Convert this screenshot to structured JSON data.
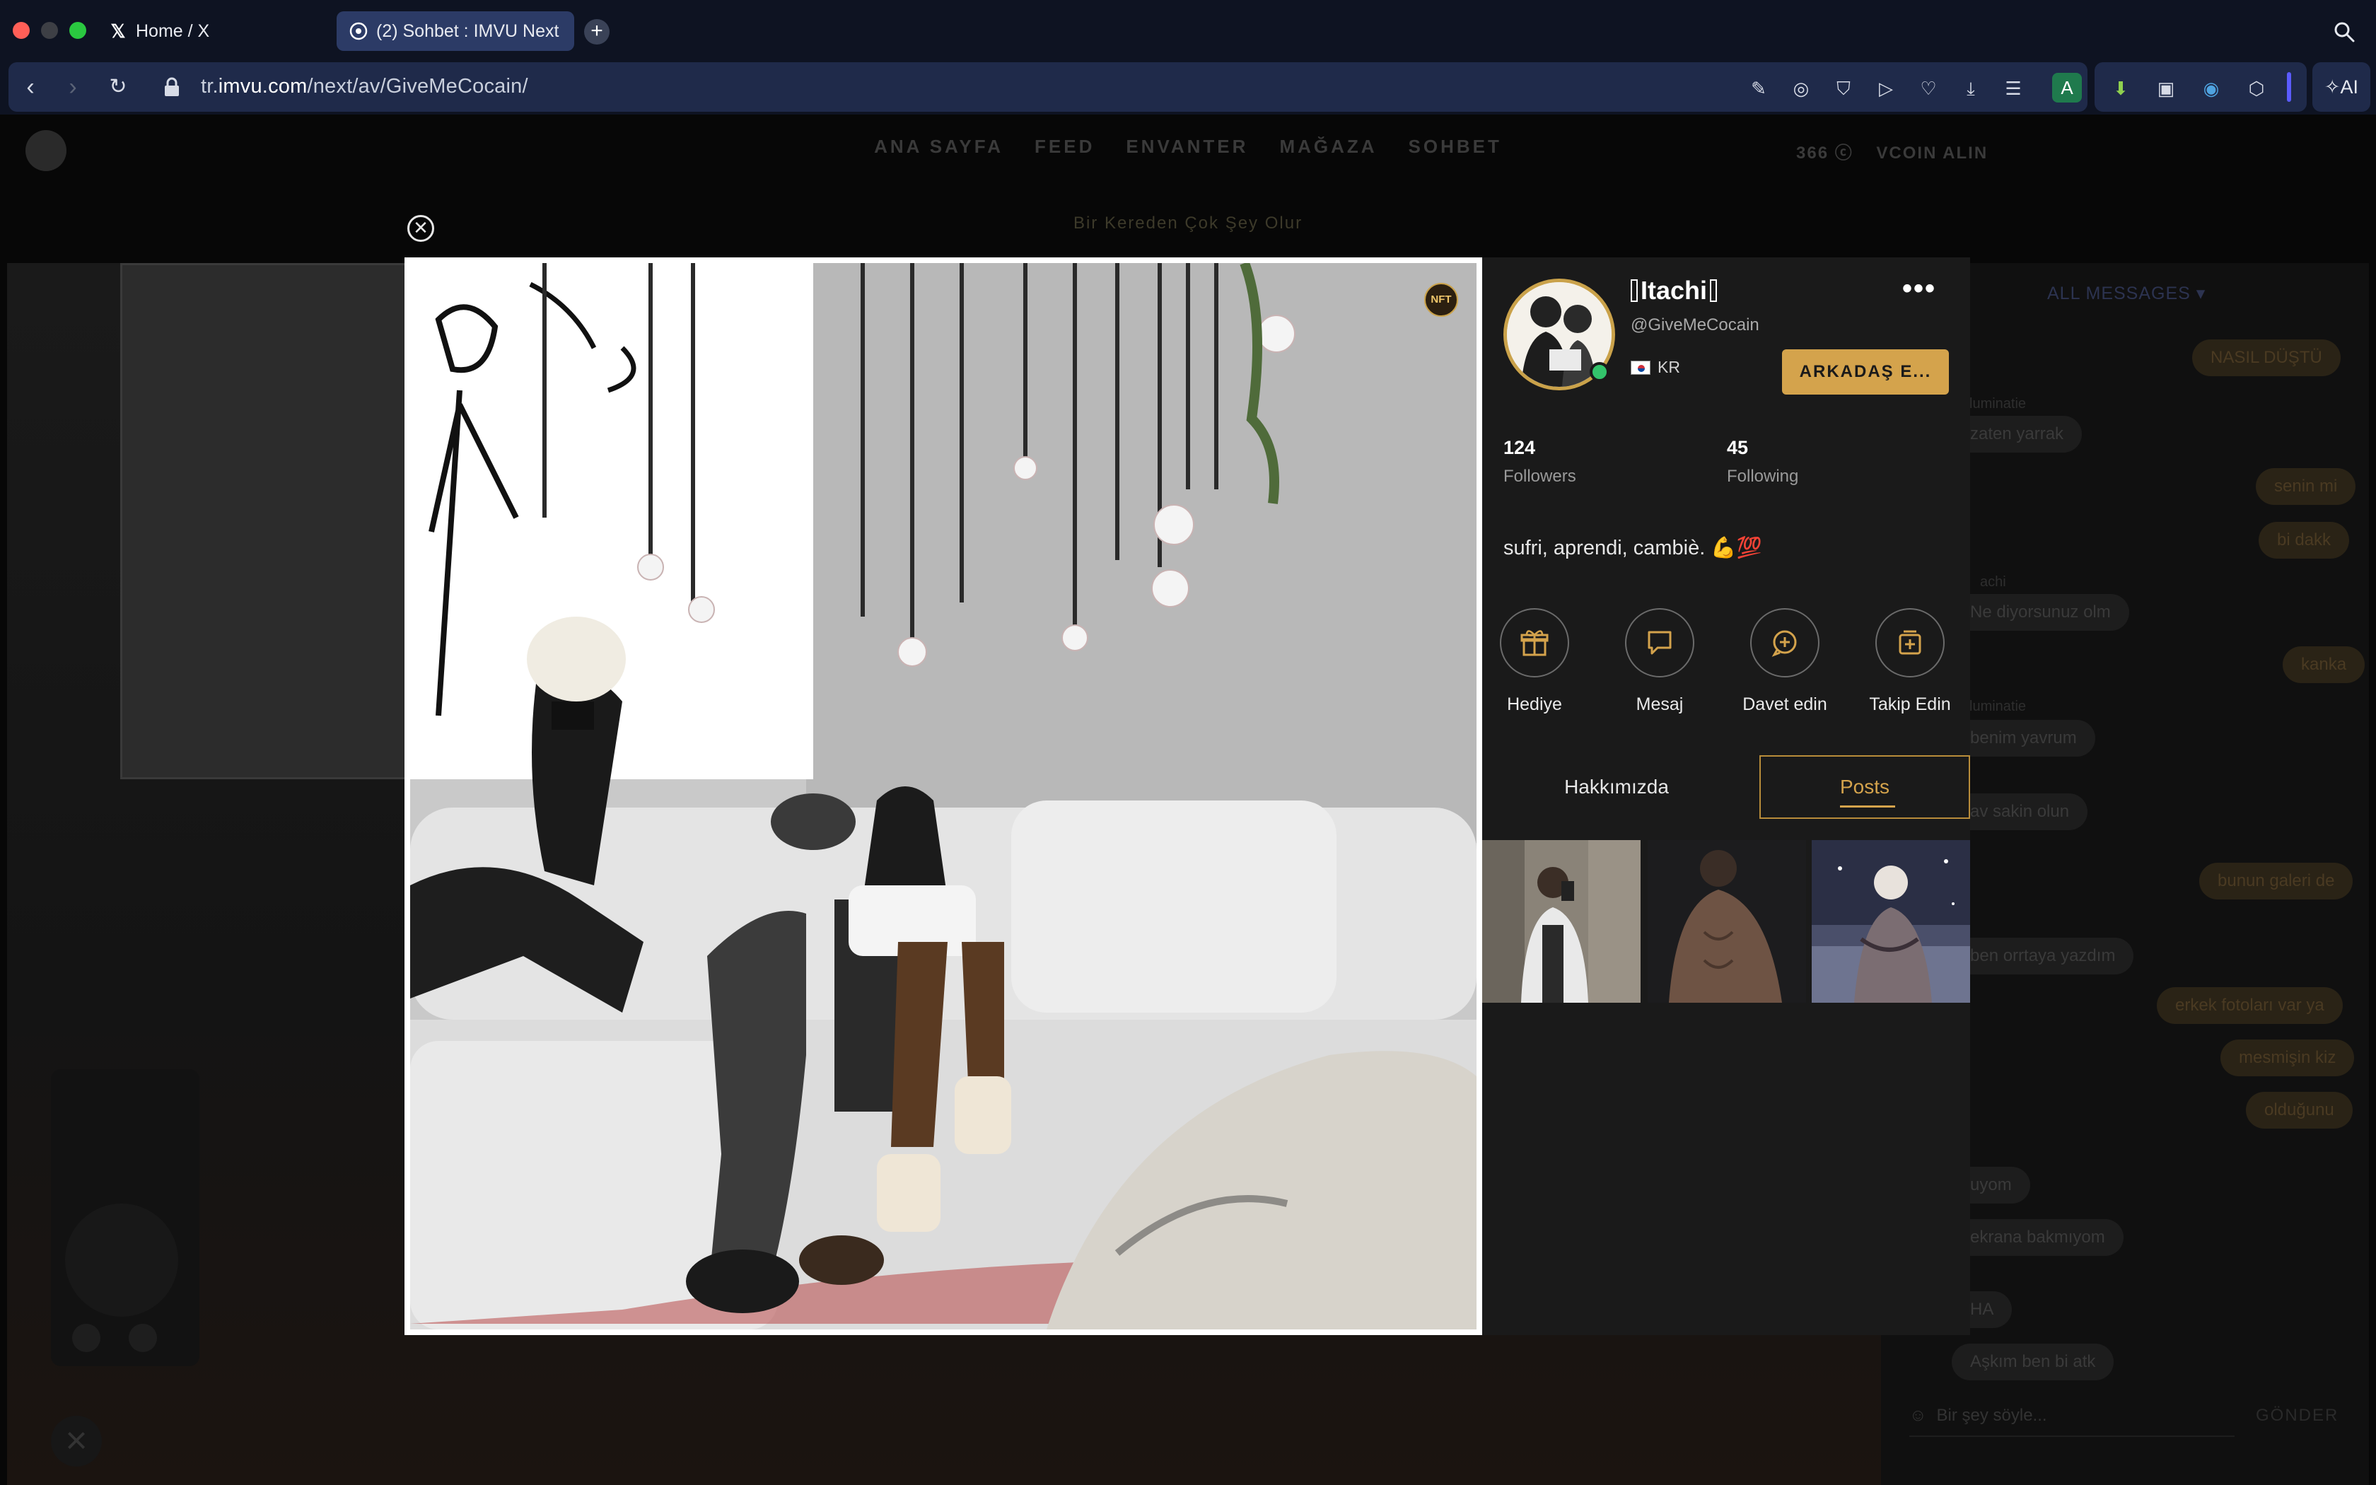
{
  "browser": {
    "tabs": [
      {
        "label": "Home / X",
        "icon": "x-logo-icon",
        "active": false
      },
      {
        "label": "(2) Sohbet : IMVU Next",
        "icon": "imvu-icon",
        "active": true
      }
    ],
    "new_tab_label": "+",
    "url_prefix": "tr.",
    "url_domain": "imvu.com",
    "url_path": "/next/av/GiveMeCocain/",
    "profile_initial": "A",
    "ai_label": "AI"
  },
  "imvu": {
    "nav": [
      "ANA SAYFA",
      "FEED",
      "ENVANTER",
      "MAĞAZA",
      "SOHBET"
    ],
    "credits": "366",
    "vcoin_label": "VCOIN ALIN",
    "banner": "Bir Kereden Çok Şey Olur",
    "chat": {
      "filter_label": "ALL MESSAGES",
      "messages": [
        {
          "text": "NASIL DÜŞTÜ",
          "side": "me"
        },
        {
          "user": "luminatie",
          "text": "zaten yarrak",
          "side": "them"
        },
        {
          "text": "senin mi",
          "side": "me"
        },
        {
          "text": "bi dakk",
          "side": "me"
        },
        {
          "user": "achi",
          "text": "Ne diyorsunuz olm",
          "side": "them"
        },
        {
          "text": "kanka",
          "side": "me"
        },
        {
          "user": "luminatie",
          "text": "benim yavrum",
          "side": "them"
        },
        {
          "text": "av sakin olun",
          "side": "them"
        },
        {
          "text": "bunun galeri de",
          "side": "me"
        },
        {
          "text": "ben orrtaya yazdım",
          "side": "them"
        },
        {
          "text": "erkek fotoları var ya",
          "side": "me"
        },
        {
          "text": "mesmişin kiz",
          "side": "me"
        },
        {
          "text": "olduğunu",
          "side": "me"
        },
        {
          "text": "uyom",
          "side": "them"
        },
        {
          "text": "ekrana bakmıyom",
          "side": "them"
        },
        {
          "text": "HA",
          "side": "them"
        },
        {
          "text": "Aşkım ben bi atk",
          "side": "them"
        }
      ],
      "input_placeholder": "Bir şey söyle...",
      "send_label": "GÖNDER"
    }
  },
  "modal": {
    "nft_label": "NFT",
    "profile": {
      "display_name": "Itachi",
      "handle": "@GiveMeCocain",
      "country": "KR",
      "friend_button": "ARKADAŞ E...",
      "followers_count": "124",
      "followers_label": "Followers",
      "following_count": "45",
      "following_label": "Following",
      "bio": "sufri, aprendi, cambiè. 💪💯",
      "actions": [
        {
          "label": "Hediye",
          "icon": "gift-icon"
        },
        {
          "label": "Mesaj",
          "icon": "message-icon"
        },
        {
          "label": "Davet edin",
          "icon": "invite-icon"
        },
        {
          "label": "Takip Edin",
          "icon": "follow-icon"
        }
      ],
      "tabs": [
        {
          "label": "Hakkımızda",
          "active": false
        },
        {
          "label": "Posts",
          "active": true
        }
      ],
      "posts_count_visible": 3
    }
  },
  "colors": {
    "accent_gold": "#d4a34c",
    "online_green": "#33c46b",
    "panel_bg": "#1a1a1a",
    "chrome_bg": "#0e1322",
    "url_bg": "#1f2a4a"
  }
}
